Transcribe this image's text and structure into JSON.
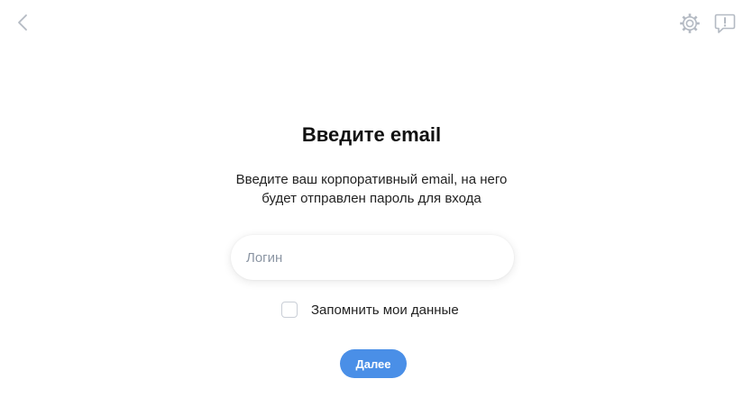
{
  "header": {
    "back_icon": "chevron-left-icon",
    "settings_icon": "gear-icon",
    "feedback_icon": "feedback-exclamation-icon",
    "icon_color": "#b4bac3"
  },
  "main": {
    "title": "Введите email",
    "subtitle_line1": "Введите ваш корпоративный email, на него",
    "subtitle_line2": "будет отправлен пароль для входа",
    "login_placeholder": "Логин",
    "login_value": "",
    "remember_label": "Запомнить мои данные",
    "remember_checked": false,
    "next_label": "Далее",
    "accent_color": "#4a8fe7"
  }
}
